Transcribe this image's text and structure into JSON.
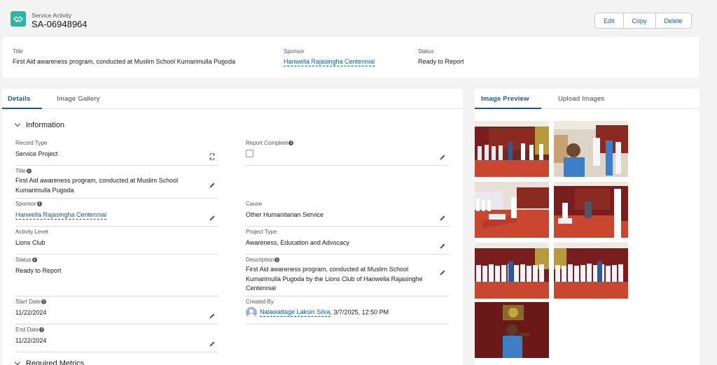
{
  "header": {
    "object_label": "Service Activity",
    "record_name": "SA-06948964",
    "actions": {
      "edit": "Edit",
      "copy": "Copy",
      "delete": "Delete"
    }
  },
  "highlights": {
    "title_label": "Title",
    "title_value": "First Aid awareness program, conducted at Muslim School Kumarimulla Pugoda",
    "sponsor_label": "Sponsor",
    "sponsor_value": "Hanwella Rajasingha Centennial",
    "status_label": "Status",
    "status_value": "Ready to Report"
  },
  "left_tabs": {
    "details": "Details",
    "gallery": "Image Gallery"
  },
  "section": {
    "information": "Information",
    "required_metrics": "Required Metrics"
  },
  "fields": {
    "record_type": {
      "label": "Record Type",
      "value": "Service Project"
    },
    "report_complete": {
      "label": "Report Complete"
    },
    "title": {
      "label": "Title",
      "value": "First Aid awareness program, conducted at Muslim School Kumarimulla Pugoda"
    },
    "sponsor": {
      "label": "Sponsor",
      "value": "Hanwella Rajasingha Centennial"
    },
    "cause": {
      "label": "Cause",
      "value": "Other Humanitarian Service"
    },
    "activity_level": {
      "label": "Activity Level",
      "value": "Lions Club"
    },
    "project_type": {
      "label": "Project Type",
      "value": "Awareness, Education and Advocacy"
    },
    "status": {
      "label": "Status",
      "value": "Ready to Report"
    },
    "description": {
      "label": "Description",
      "value": "First Aid awareness program, conducted at Muslim School Kumarimulla Pugoda by the Lions Club of Hanwella Rajasinghe Centennial"
    },
    "start_date": {
      "label": "Start Date",
      "value": "11/22/2024"
    },
    "created_by": {
      "label": "Created By",
      "user": "Nalawattage Laksiri Silva",
      "datetime": ", 3/7/2025, 12:50 PM"
    },
    "end_date": {
      "label": "End Date",
      "value": "11/22/2024"
    }
  },
  "right_tabs": {
    "preview": "Image Preview",
    "upload": "Upload Images"
  },
  "colors": {
    "brand": "#0b5cab",
    "icon_bg": "#2bb5a4",
    "curtain": "#7a1d1d",
    "floor": "#c9472f"
  }
}
